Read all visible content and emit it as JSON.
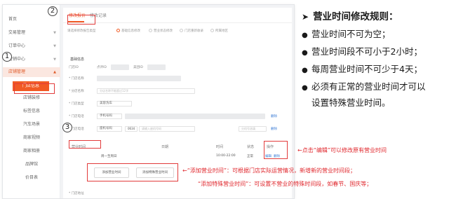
{
  "sidebar": {
    "items": [
      {
        "label": "首页"
      },
      {
        "label": "交易管理"
      },
      {
        "label": "订单中心"
      },
      {
        "label": "营销中心"
      },
      {
        "label": "店铺管理"
      },
      {
        "label": "门店信息"
      },
      {
        "label": "店铺装修"
      },
      {
        "label": "标签信息"
      },
      {
        "label": "汽车场景"
      },
      {
        "label": "商家视频"
      },
      {
        "label": "商家相册"
      },
      {
        "label": "品牌馆"
      },
      {
        "label": "价目表"
      }
    ]
  },
  "tabs": [
    {
      "label": "修改报价"
    },
    {
      "label": "修改记录"
    }
  ],
  "radios": [
    {
      "label": "请选择修改报告类型"
    },
    {
      "label": "基础信息修改"
    },
    {
      "label": "营业状态修改"
    },
    {
      "label": "门店重新收录"
    },
    {
      "label": "所属地区"
    }
  ],
  "basic_info": {
    "section_title": "基础信息",
    "store_id_label": "门店ID",
    "store_id_prefix": "点评ID",
    "meituan_id_prefix": "美团ID",
    "fields": [
      {
        "label": "* 门店名称"
      },
      {
        "label": "* 分店名称",
        "placeholder": "分店名称不能超过12字"
      },
      {
        "label": "* 门店类型",
        "value": "美容洗车"
      },
      {
        "label": "* 门店电话",
        "select": "手机号码",
        "link": "删除"
      },
      {
        "label": "* 门店电话",
        "select": "座机号码",
        "area_code": "0634",
        "placeholder": "请输入座机号码",
        "ext_placeholder": "分机号选填",
        "link": "删除"
      }
    ]
  },
  "business_hours": {
    "section_title": "营业时间",
    "col_date": "日期",
    "col_time": "时间",
    "col_status": "状态",
    "col_action": "操作",
    "row": {
      "date": "周一至周日",
      "time": "10:00-22:00",
      "status": "正常",
      "edit": "编辑",
      "delete": "删除"
    },
    "add_button": "添加营业时间",
    "add_special_button": "添加特殊营业时间",
    "address_label": "* 门店地址"
  },
  "callouts": {
    "one": "1",
    "two": "2",
    "three": "3"
  },
  "annotations": {
    "edit_note": "←点击“编辑”可以修改原有营业时间",
    "add_note": "←“添加营业时间”：可根据门店实际运营情况，新增新的营业时间段；",
    "special_note": "“添加特殊营业时间”：可设置不营业的特殊时间段，如春节、国庆等；"
  },
  "rules": {
    "title": "营业时间修改规则：",
    "items": [
      "营业时间不可为空；",
      "营业时间段不可小于2小时；",
      "每周营业时间不可少于4天；",
      "必须有正常的营业时间才可以",
      "设置特殊营业时间。"
    ]
  },
  "colors": {
    "accent": "#f15a24",
    "annotation_red": "#e0282e",
    "link_blue": "#3a7bd5"
  }
}
